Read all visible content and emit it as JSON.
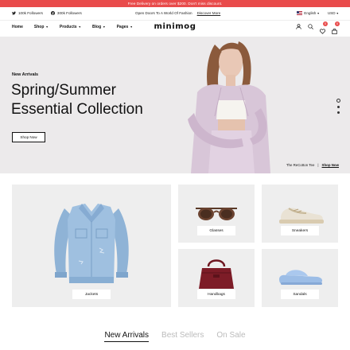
{
  "announcement": "Free Delivery on orders over $200. Don't miss discount.",
  "infobar": {
    "followers": [
      {
        "icon": "twitter-icon",
        "text": "100k Followers"
      },
      {
        "icon": "facebook-icon",
        "text": "300k Followers"
      }
    ],
    "promo_text": "Open Doors To A World Of Fashion",
    "promo_link": "Discover More",
    "language": "English",
    "currency": "USD"
  },
  "header": {
    "logo": "minimog",
    "nav": [
      {
        "label": "Home",
        "dropdown": false
      },
      {
        "label": "Shop",
        "dropdown": true
      },
      {
        "label": "Products",
        "dropdown": true
      },
      {
        "label": "Blog",
        "dropdown": true
      },
      {
        "label": "Pages",
        "dropdown": true
      }
    ],
    "wishlist_count": "0",
    "cart_count": "0"
  },
  "hero": {
    "eyebrow": "New Arrivals",
    "title_line1": "Spring/Summer",
    "title_line2": "Essential Collection",
    "button": "Shop Now",
    "caption": "The ReCotton Tee",
    "caption_link": "Shop Now"
  },
  "categories": {
    "jackets": "Jackets",
    "glasses": "Glasses",
    "sneakers": "Sneakers",
    "handbags": "Handbags",
    "sandals": "Sandals"
  },
  "tabs": [
    "New Arrivals",
    "Best Sellers",
    "On Sale"
  ],
  "colors": {
    "accent": "#e94b4b",
    "hero_bg": "#eceaeb",
    "tile_bg": "#eeeeee"
  }
}
